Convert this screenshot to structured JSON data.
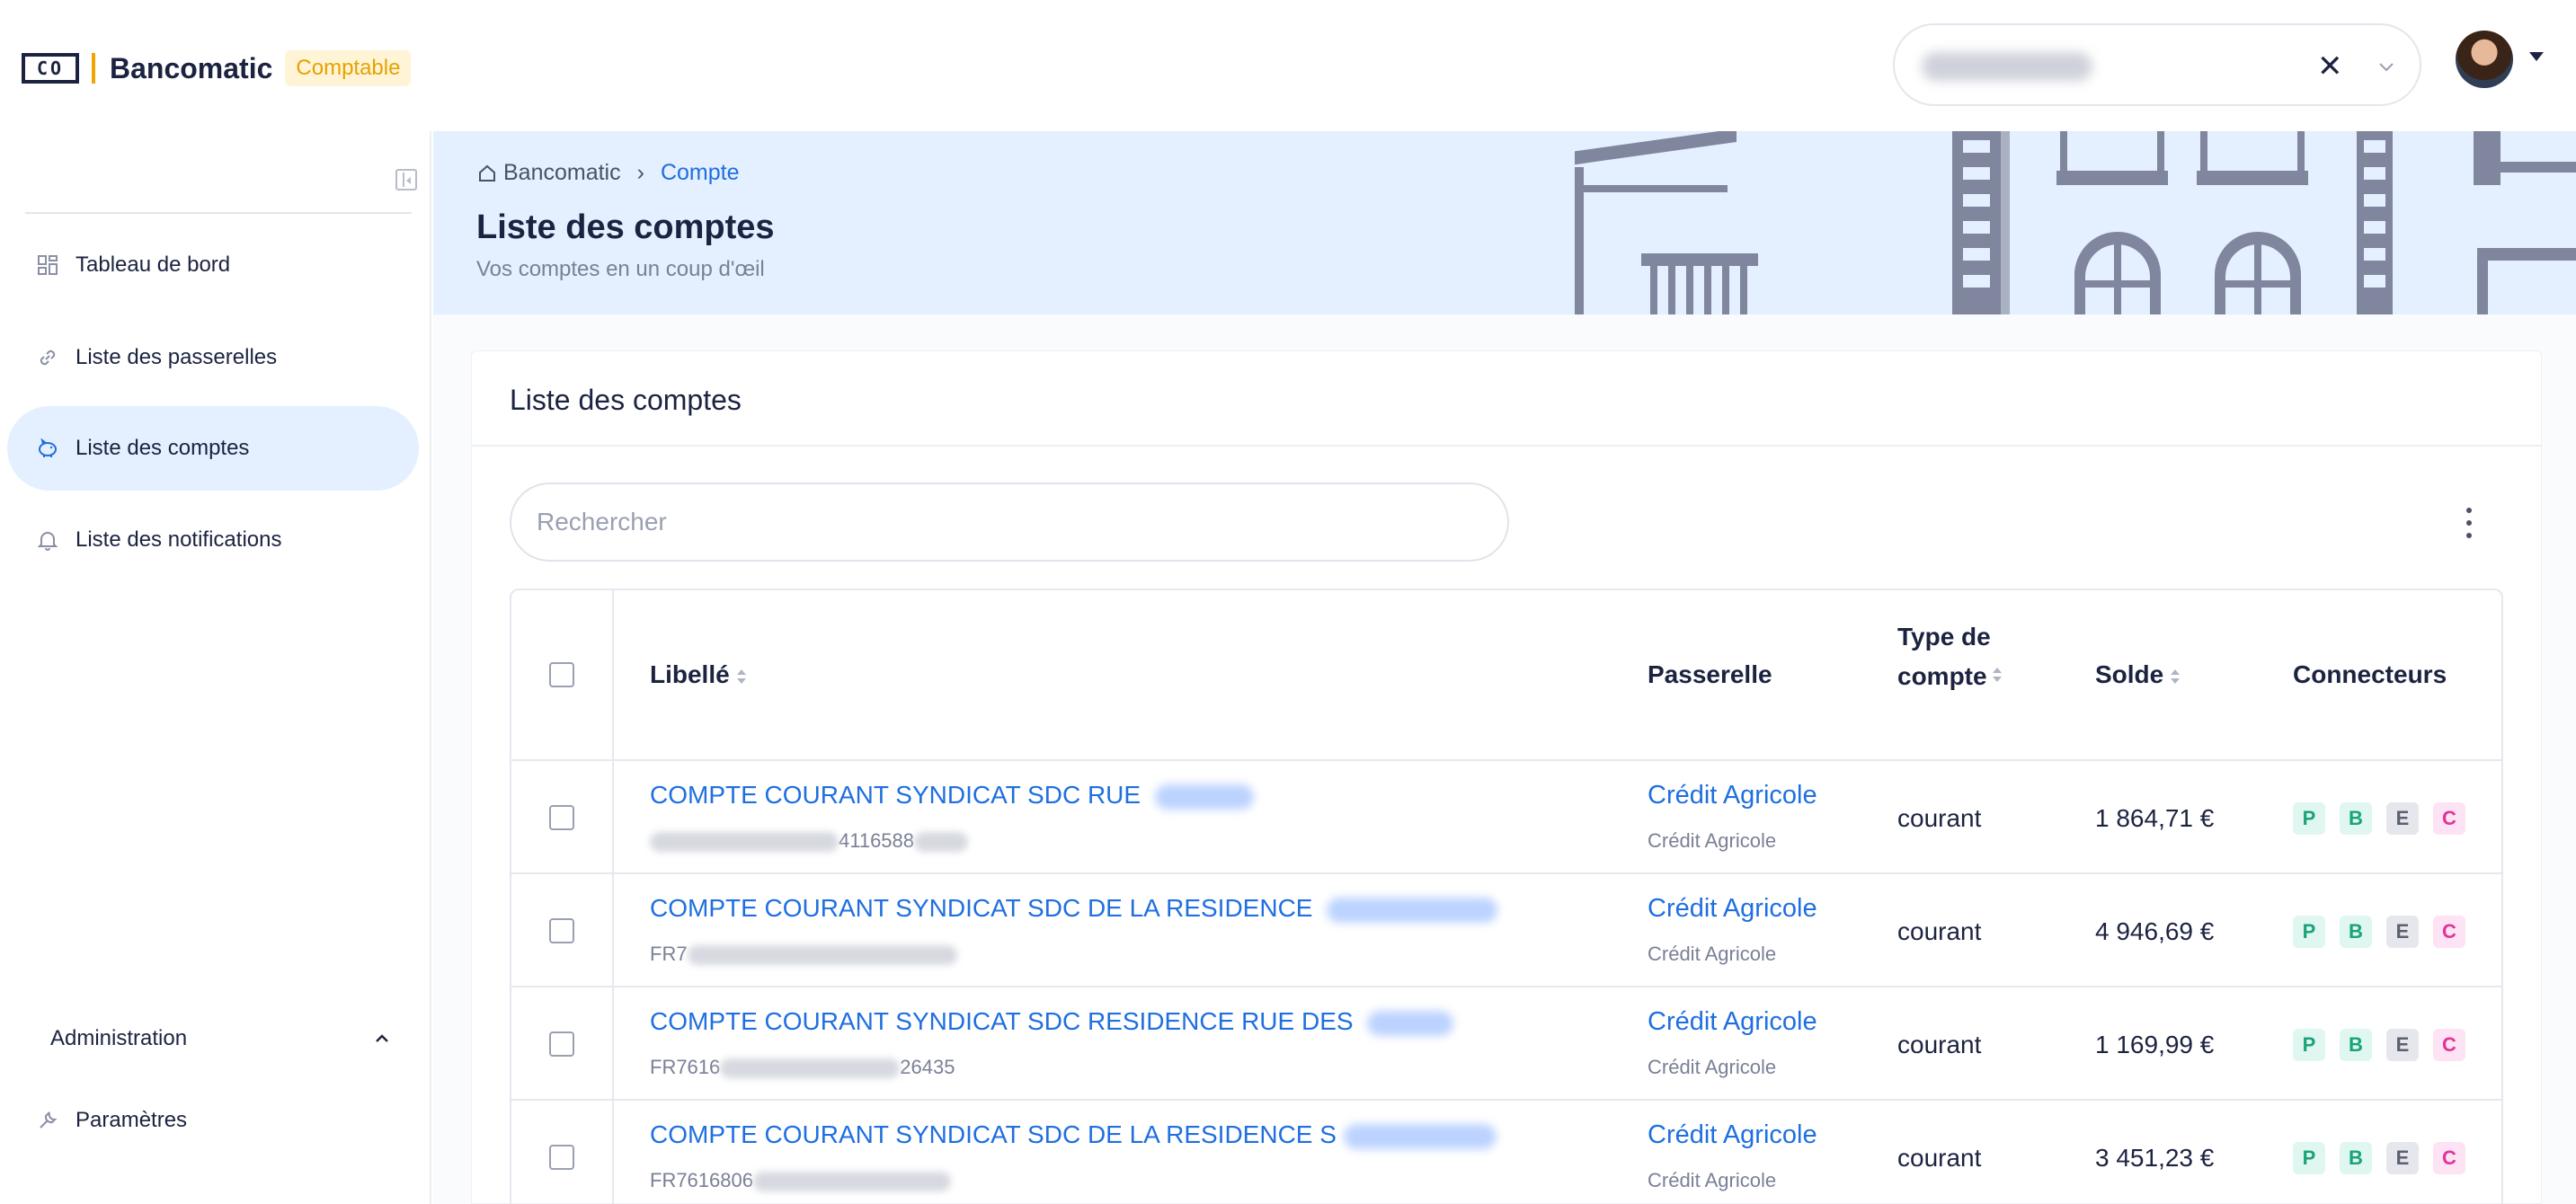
{
  "app": {
    "logo_text": "CO",
    "name": "Bancomatic",
    "badge": "Comptable"
  },
  "header": {
    "account_select": {
      "value_redacted": true,
      "clear_icon": "close-icon",
      "chevron_icon": "chevron-down-icon"
    },
    "user_menu_icon": "caret-down-icon"
  },
  "sidebar": {
    "items": [
      {
        "label": "Tableau de bord",
        "icon": "dashboard-icon",
        "active": false
      },
      {
        "label": "Liste des passerelles",
        "icon": "link-icon",
        "active": false
      },
      {
        "label": "Liste des comptes",
        "icon": "piggy-bank-icon",
        "active": true
      },
      {
        "label": "Liste des notifications",
        "icon": "bell-icon",
        "active": false
      }
    ],
    "admin": {
      "label": "Administration",
      "items": [
        {
          "label": "Paramètres",
          "icon": "wrench-icon"
        }
      ]
    }
  },
  "breadcrumb": {
    "home": "Bancomatic",
    "current": "Compte"
  },
  "page": {
    "title": "Liste des comptes",
    "subtitle": "Vos comptes en un coup d'œil"
  },
  "card": {
    "title": "Liste des comptes",
    "search_placeholder": "Rechercher"
  },
  "table": {
    "headers": {
      "libelle": "Libellé",
      "passerelle": "Passerelle",
      "type": "Type de compte",
      "solde": "Solde",
      "connecteurs": "Connecteurs"
    },
    "rows": [
      {
        "label": "COMPTE COURANT SYNDICAT SDC RUE ",
        "iban_prefix": "",
        "iban_suffix": "4116588",
        "gateway": "Crédit Agricole",
        "gateway_sub": "Crédit Agricole",
        "type": "courant",
        "solde": "1 864,71 €",
        "connectors": [
          "P",
          "B",
          "E",
          "C"
        ]
      },
      {
        "label": "COMPTE COURANT SYNDICAT SDC DE LA RESIDENCE ",
        "iban_prefix": "FR7",
        "iban_suffix": "",
        "gateway": "Crédit Agricole",
        "gateway_sub": "Crédit Agricole",
        "type": "courant",
        "solde": "4 946,69 €",
        "connectors": [
          "P",
          "B",
          "E",
          "C"
        ]
      },
      {
        "label": "COMPTE COURANT SYNDICAT SDC RESIDENCE RUE DES ",
        "iban_prefix": "FR7616",
        "iban_suffix": "26435",
        "gateway": "Crédit Agricole",
        "gateway_sub": "Crédit Agricole",
        "type": "courant",
        "solde": "1 169,99 €",
        "connectors": [
          "P",
          "B",
          "E",
          "C"
        ]
      },
      {
        "label": "COMPTE COURANT SYNDICAT SDC DE LA RESIDENCE S",
        "iban_prefix": "FR7616806",
        "iban_suffix": "",
        "gateway": "Crédit Agricole",
        "gateway_sub": "Crédit Agricole",
        "type": "courant",
        "solde": "3 451,23 €",
        "connectors": [
          "P",
          "B",
          "E",
          "C"
        ]
      }
    ]
  },
  "colors": {
    "accent": "#1f6fe0",
    "hero_bg": "#e4efff",
    "brand_yellow": "#f0a500",
    "text_dark": "#1c2340"
  }
}
